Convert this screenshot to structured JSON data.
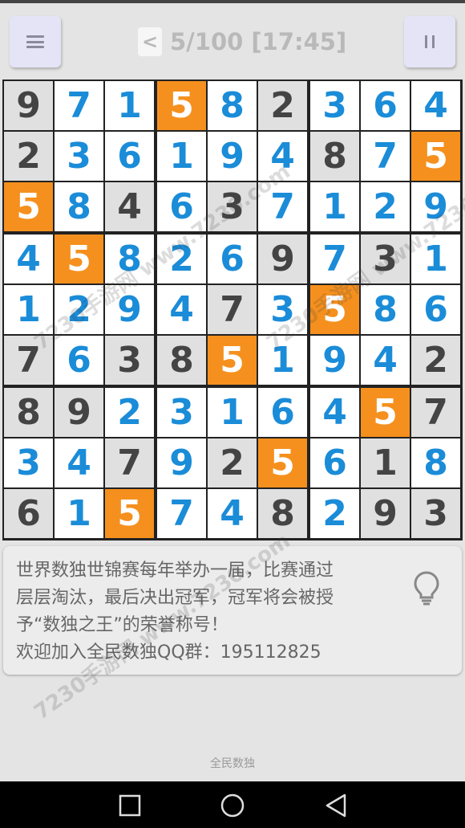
{
  "header": {
    "back_glyph": "<",
    "title": "5/100 [17:45]"
  },
  "board": {
    "rows": [
      [
        {
          "v": "9",
          "t": "g"
        },
        {
          "v": "7",
          "t": "f"
        },
        {
          "v": "1",
          "t": "f"
        },
        {
          "v": "5",
          "t": "h"
        },
        {
          "v": "8",
          "t": "f"
        },
        {
          "v": "2",
          "t": "g"
        },
        {
          "v": "3",
          "t": "f"
        },
        {
          "v": "6",
          "t": "f"
        },
        {
          "v": "4",
          "t": "f"
        }
      ],
      [
        {
          "v": "2",
          "t": "g"
        },
        {
          "v": "3",
          "t": "f"
        },
        {
          "v": "6",
          "t": "f"
        },
        {
          "v": "1",
          "t": "f"
        },
        {
          "v": "9",
          "t": "f"
        },
        {
          "v": "4",
          "t": "f"
        },
        {
          "v": "8",
          "t": "g"
        },
        {
          "v": "7",
          "t": "f"
        },
        {
          "v": "5",
          "t": "h"
        }
      ],
      [
        {
          "v": "5",
          "t": "h"
        },
        {
          "v": "8",
          "t": "f"
        },
        {
          "v": "4",
          "t": "g"
        },
        {
          "v": "6",
          "t": "f"
        },
        {
          "v": "3",
          "t": "g"
        },
        {
          "v": "7",
          "t": "f"
        },
        {
          "v": "1",
          "t": "f"
        },
        {
          "v": "2",
          "t": "f"
        },
        {
          "v": "9",
          "t": "f"
        }
      ],
      [
        {
          "v": "4",
          "t": "f"
        },
        {
          "v": "5",
          "t": "h"
        },
        {
          "v": "8",
          "t": "f"
        },
        {
          "v": "2",
          "t": "f"
        },
        {
          "v": "6",
          "t": "f"
        },
        {
          "v": "9",
          "t": "g"
        },
        {
          "v": "7",
          "t": "f"
        },
        {
          "v": "3",
          "t": "g"
        },
        {
          "v": "1",
          "t": "f"
        }
      ],
      [
        {
          "v": "1",
          "t": "f"
        },
        {
          "v": "2",
          "t": "f"
        },
        {
          "v": "9",
          "t": "f"
        },
        {
          "v": "4",
          "t": "f"
        },
        {
          "v": "7",
          "t": "g"
        },
        {
          "v": "3",
          "t": "f"
        },
        {
          "v": "5",
          "t": "h"
        },
        {
          "v": "8",
          "t": "f"
        },
        {
          "v": "6",
          "t": "f"
        }
      ],
      [
        {
          "v": "7",
          "t": "g"
        },
        {
          "v": "6",
          "t": "f"
        },
        {
          "v": "3",
          "t": "g"
        },
        {
          "v": "8",
          "t": "g"
        },
        {
          "v": "5",
          "t": "h"
        },
        {
          "v": "1",
          "t": "f"
        },
        {
          "v": "9",
          "t": "f"
        },
        {
          "v": "4",
          "t": "f"
        },
        {
          "v": "2",
          "t": "g"
        }
      ],
      [
        {
          "v": "8",
          "t": "g"
        },
        {
          "v": "9",
          "t": "g"
        },
        {
          "v": "2",
          "t": "f"
        },
        {
          "v": "3",
          "t": "f"
        },
        {
          "v": "1",
          "t": "f"
        },
        {
          "v": "6",
          "t": "f"
        },
        {
          "v": "4",
          "t": "f"
        },
        {
          "v": "5",
          "t": "h"
        },
        {
          "v": "7",
          "t": "g"
        }
      ],
      [
        {
          "v": "3",
          "t": "f"
        },
        {
          "v": "4",
          "t": "f"
        },
        {
          "v": "7",
          "t": "g"
        },
        {
          "v": "9",
          "t": "f"
        },
        {
          "v": "2",
          "t": "g"
        },
        {
          "v": "5",
          "t": "h"
        },
        {
          "v": "6",
          "t": "f"
        },
        {
          "v": "1",
          "t": "g"
        },
        {
          "v": "8",
          "t": "f"
        }
      ],
      [
        {
          "v": "6",
          "t": "g"
        },
        {
          "v": "1",
          "t": "f"
        },
        {
          "v": "5",
          "t": "h"
        },
        {
          "v": "7",
          "t": "f"
        },
        {
          "v": "4",
          "t": "f"
        },
        {
          "v": "8",
          "t": "g"
        },
        {
          "v": "2",
          "t": "f"
        },
        {
          "v": "9",
          "t": "g"
        },
        {
          "v": "3",
          "t": "g"
        }
      ]
    ]
  },
  "hint": {
    "line1": "世界数独世锦赛每年举办一届，比赛通过",
    "line2": "层层淘汰，最后决出冠军，冠军将会被授",
    "line3": "予“数独之王”的荣誉称号！",
    "line4": "欢迎加入全民数独QQ群：195112825"
  },
  "footer": {
    "app_name": "全民数独"
  },
  "watermarks": [
    "7230手游网 www.7230.com",
    "7230手游网 www.7230.com",
    "7230手游网 www.7230.com"
  ],
  "colors": {
    "given_bg": "#e0e0e0",
    "given_text": "#444444",
    "filled_bg": "#ffffff",
    "filled_text": "#1a8cd8",
    "highlight_bg": "#f5901e",
    "highlight_text": "#ffffff"
  },
  "icons": {
    "menu": "menu-icon",
    "pause": "pause-icon",
    "back": "back-arrow-icon",
    "hint": "lightbulb-icon",
    "nav_recent": "recent-apps-icon",
    "nav_home": "home-icon",
    "nav_back": "nav-back-icon"
  }
}
